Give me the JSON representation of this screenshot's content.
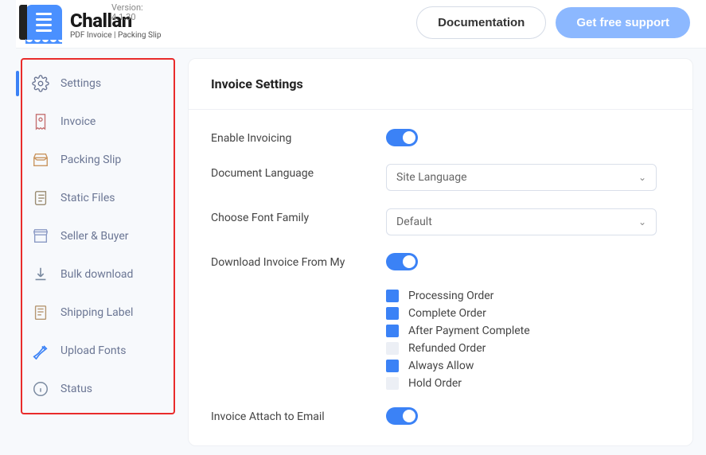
{
  "header": {
    "version_label": "Version: 4.1.30",
    "brand_name": "Challan",
    "brand_sub": "PDF Invoice | Packing Slip",
    "doc_button": "Documentation",
    "support_button": "Get free support"
  },
  "sidebar": {
    "items": [
      {
        "label": "Settings"
      },
      {
        "label": "Invoice"
      },
      {
        "label": "Packing Slip"
      },
      {
        "label": "Static Files"
      },
      {
        "label": "Seller & Buyer"
      },
      {
        "label": "Bulk download"
      },
      {
        "label": "Shipping Label"
      },
      {
        "label": "Upload Fonts"
      },
      {
        "label": "Status"
      }
    ]
  },
  "card": {
    "title": "Invoice Settings",
    "enable_invoicing": "Enable Invoicing",
    "doc_lang_label": "Document Language",
    "doc_lang_value": "Site Language",
    "font_label": "Choose Font Family",
    "font_value": "Default",
    "download_label": "Download Invoice From My",
    "checks": [
      {
        "label": "Processing Order",
        "on": true
      },
      {
        "label": "Complete Order",
        "on": true
      },
      {
        "label": "After Payment Complete",
        "on": true
      },
      {
        "label": "Refunded Order",
        "on": false
      },
      {
        "label": "Always Allow",
        "on": true
      },
      {
        "label": "Hold Order",
        "on": false
      }
    ],
    "attach_label": "Invoice Attach to Email"
  }
}
